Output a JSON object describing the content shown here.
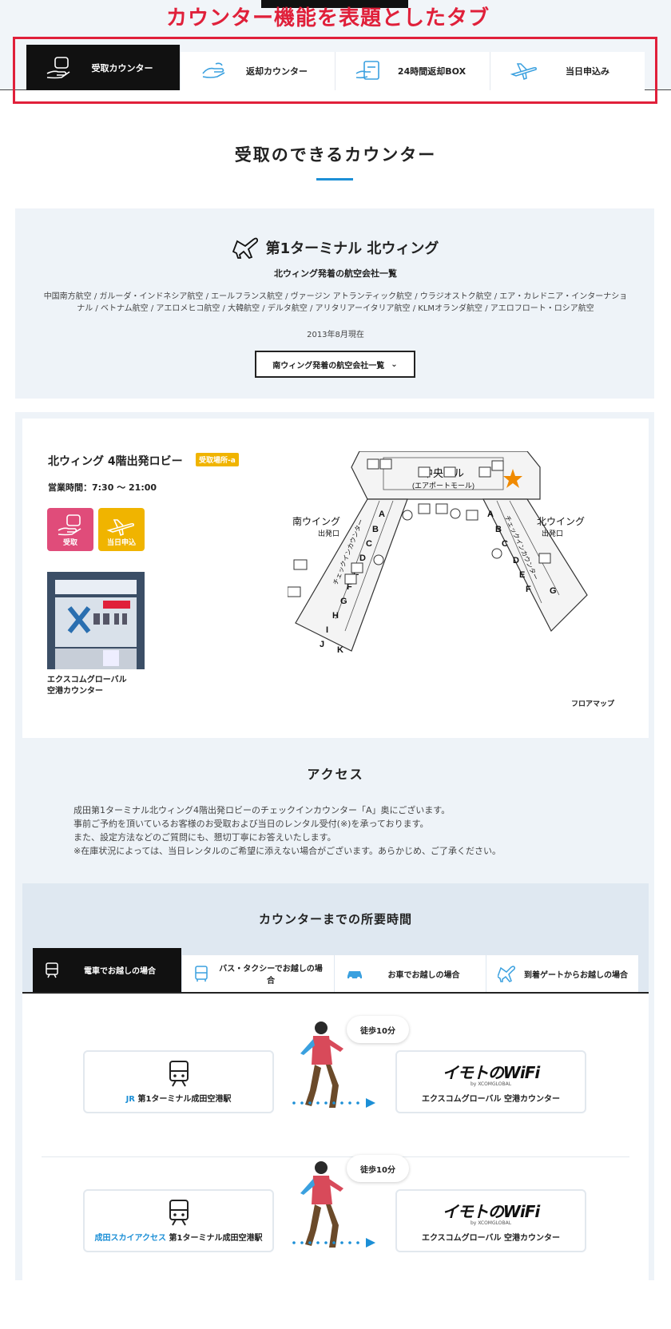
{
  "annotation": "カウンター機能を表題としたタブ",
  "top_tabs": [
    {
      "label": "受取カウンター",
      "icon": "receive-hand-icon"
    },
    {
      "label": "返却カウンター",
      "icon": "return-hand-icon"
    },
    {
      "label": "24時間返却BOX",
      "icon": "return-box-icon"
    },
    {
      "label": "当日申込み",
      "icon": "airplane-icon"
    }
  ],
  "section_title": "受取のできるカウンター",
  "terminal": {
    "name": "第1ターミナル 北ウィング",
    "airline_subtitle": "北ウィング発着の航空会社一覧",
    "airlines": "中国南方航空 / ガルーダ・インドネシア航空 / エールフランス航空 / ヴァージン アトランティック航空 / ウラジオストク航空 / エア・カレドニア・インターナショナル / ベトナム航空 / アエロメヒコ航空 / 大韓航空 / デルタ航空 / アリタリアーイタリア航空 / KLMオランダ航空 / アエロフロート・ロシア航空",
    "date": "2013年8月現在",
    "south_button": "南ウィング発着の航空会社一覧"
  },
  "counter": {
    "title": "北ウィング 4階出発ロビー",
    "badge": "受取場所-a",
    "hours": "営業時間：7:30 〜 21:00",
    "services": [
      {
        "label": "受取",
        "color": "#e04c7a",
        "icon": "receive-hand-icon"
      },
      {
        "label": "当日申込",
        "color": "#f0b400",
        "icon": "airplane-icon"
      }
    ],
    "photo_caption_line1": "エクスコムグローバル",
    "photo_caption_line2": "空港カウンター",
    "floor_map_link": "フロアマップ"
  },
  "floor_map": {
    "center": "中央ビル",
    "center_sub": "(エアポートモール)",
    "south": "南ウイング",
    "south_sub": "出発口",
    "north": "北ウイング",
    "north_sub": "出発口",
    "checkin": "チェックインカウンター",
    "south_letters": [
      "A",
      "B",
      "C",
      "D",
      "E",
      "F",
      "G",
      "H",
      "I",
      "J",
      "K"
    ],
    "north_letters": [
      "A",
      "B",
      "C",
      "D",
      "E",
      "F",
      "G"
    ]
  },
  "access": {
    "title": "アクセス",
    "lines": [
      "成田第1ターミナル北ウィング4階出発ロビーのチェックインカウンター「A」奥にございます。",
      "事前ご予約を頂いているお客様のお受取および当日のレンタル受付(※)を承っております。",
      "また、設定方法などのご質問にも、懇切丁寧にお答えいたします。",
      "※在庫状況によっては、当日レンタルのご希望に添えない場合がございます。あらかじめ、ご了承ください。"
    ]
  },
  "time_section": {
    "title": "カウンターまでの所要時間",
    "tabs": [
      {
        "label": "電車でお越しの場合",
        "icon": "train-icon"
      },
      {
        "label": "バス・タクシーでお越しの場合",
        "icon": "bus-icon"
      },
      {
        "label": "お車でお越しの場合",
        "icon": "car-icon"
      },
      {
        "label": "到着ゲートからお越しの場合",
        "icon": "airplane-icon"
      }
    ],
    "routes": [
      {
        "from_highlight": "JR",
        "from_rest": " 第1ターミナル成田空港駅",
        "walk": "徒歩10分",
        "to": "エクスコムグローバル 空港カウンター"
      },
      {
        "from_highlight": "成田スカイアクセス",
        "from_rest": " 第1ターミナル成田空港駅",
        "walk": "徒歩10分",
        "to": "エクスコムグローバル 空港カウンター"
      }
    ],
    "logo_main": "イモトのWiFi",
    "logo_sub": "by XCOMGLOBAL"
  }
}
